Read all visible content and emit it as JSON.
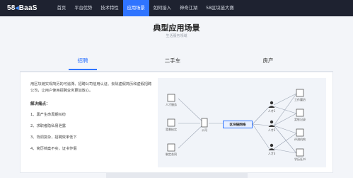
{
  "brand": {
    "logo_text": "58",
    "logo_suffix": "BaaS"
  },
  "nav": {
    "items": [
      "首页",
      "平台优势",
      "技术特性",
      "应用场景",
      "如何接入",
      "神奇江湖",
      "58区块链大赛"
    ],
    "active_index": 3
  },
  "section": {
    "title": "典型应用场景",
    "subtitle": "生活服务领域"
  },
  "tabs": [
    "招聘",
    "二手车",
    "房产"
  ],
  "active_tab": 0,
  "content": {
    "description": "用区块链实现简历的可追溯、招聘公司信用认证、去除虚假简历和虚假招聘公司，让用户使用招聘业务更加放心。",
    "pain_title": "解决痛点：",
    "pain_points": [
      "1、黑产生命周期纠纷",
      "2、求职者隐私易泄露",
      "3、背调复杂，招聘效率低下",
      "4、简历档案不实，证书作假"
    ]
  },
  "diagram": {
    "center_label": "区块链网络",
    "left_nodes": [
      "人才服务",
      "背景核实",
      "制定合同"
    ],
    "company_label": "公司",
    "people": [
      "人才1",
      "人才2",
      "人才3"
    ],
    "right_nodes": [
      "工作履历",
      "奖惩记录",
      "评测机构",
      "学历证书"
    ]
  },
  "colors": {
    "accent": "#2f74ff",
    "nav_bg": "#1e2230"
  }
}
